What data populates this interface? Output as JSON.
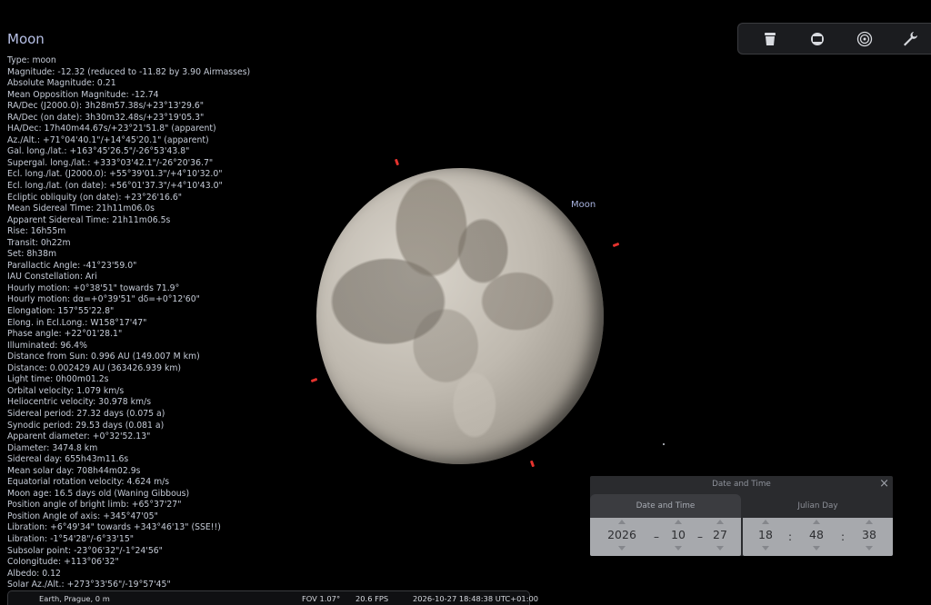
{
  "object": {
    "title": "Moon",
    "sky_label": "Moon",
    "lines": [
      "Type: moon",
      "Magnitude: -12.32 (reduced to -11.82 by 3.90 Airmasses)",
      "Absolute Magnitude: 0.21",
      "Mean Opposition Magnitude: -12.74",
      "RA/Dec (J2000.0): 3h28m57.38s/+23°13'29.6\"",
      "RA/Dec (on date): 3h30m32.48s/+23°19'05.3\"",
      "HA/Dec: 17h40m44.67s/+23°21'51.8\" (apparent)",
      "Az./Alt.: +71°04'40.1\"/+14°45'20.1\" (apparent)",
      "Gal. long./lat.: +163°45'26.5\"/-26°53'43.8\"",
      "Supergal. long./lat.: +333°03'42.1\"/-26°20'36.7\"",
      "Ecl. long./lat. (J2000.0): +55°39'01.3\"/+4°10'32.0\"",
      "Ecl. long./lat. (on date): +56°01'37.3\"/+4°10'43.0\"",
      "Ecliptic obliquity (on date): +23°26'16.6\"",
      "Mean Sidereal Time: 21h11m06.0s",
      "Apparent Sidereal Time: 21h11m06.5s",
      "Rise: 16h55m",
      "Transit: 0h22m",
      "Set: 8h38m",
      "Parallactic Angle: -41°23'59.0\"",
      "IAU Constellation: Ari",
      "Hourly motion: +0°38'51\" towards 71.9°",
      "Hourly motion: dα=+0°39'51\" dδ=+0°12'60\"",
      "Elongation: 157°55'22.8\"",
      "Elong. in Ecl.Long.: W158°17'47\"",
      "Phase angle: +22°01'28.1\"",
      "Illuminated: 96.4%",
      "Distance from Sun: 0.996 AU (149.007 M km)",
      "Distance: 0.002429 AU (363426.939 km)",
      "Light time: 0h00m01.2s",
      "Orbital velocity: 1.079 km/s",
      "Heliocentric velocity: 30.978 km/s",
      "Sidereal period: 27.32 days (0.075 a)",
      "Synodic period: 29.53 days (0.081 a)",
      "Apparent diameter: +0°32'52.13\"",
      "Diameter: 3474.8 km",
      "Sidereal day: 655h43m11.6s",
      "Mean solar day: 708h44m02.9s",
      "Equatorial rotation velocity: 4.624 m/s",
      "Moon age: 16.5 days old (Waning Gibbous)",
      "Position angle of bright limb: +65°37'27\"",
      "Position Angle of axis: +345°47'05\"",
      "Libration: +6°49'34\" towards +343°46'13\" (SSE!!)",
      "Libration: -1°54'28\"/-6°33'15\"",
      "Subsolar point: -23°06'32\"/-1°24'56\"",
      "Colongitude: +113°06'32\"",
      "Albedo: 0.12",
      "Solar Az./Alt.: +273°33'56\"/-19°57'45\""
    ]
  },
  "toolbar": {
    "icons": [
      "trash-icon",
      "square-icon",
      "target-icon",
      "wrench-icon"
    ]
  },
  "date_time_dialog": {
    "title": "Date and Time",
    "close_symbol": "×",
    "tab_date_time": "Date and Time",
    "tab_julian_day": "Julian Day",
    "year": "2026",
    "month": "10",
    "day": "27",
    "hour": "18",
    "minute": "48",
    "second": "38",
    "date_separator": "–",
    "time_separator": ":"
  },
  "status_bar": {
    "location": "Earth, Prague, 0 m",
    "fov": "FOV 1.07°",
    "fps": "20.6 FPS",
    "datetime": "2026-10-27 18:48:38 UTC+01:00"
  },
  "colors": {
    "background": "#000000",
    "label_blue": "#a9b4e0",
    "marker_red": "#e5332e"
  }
}
